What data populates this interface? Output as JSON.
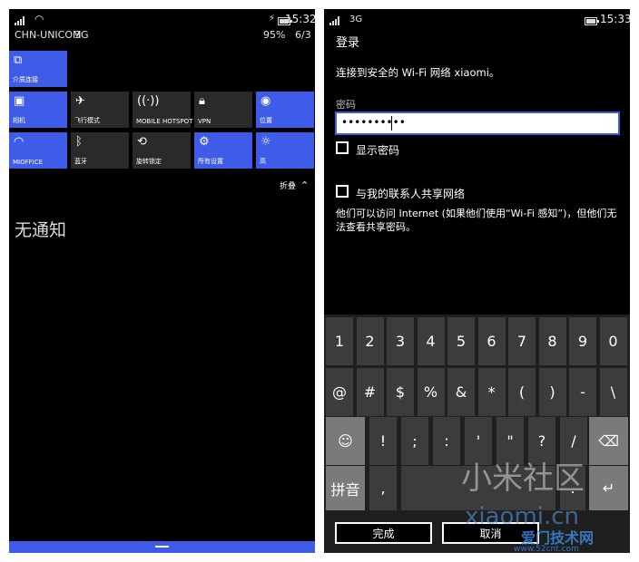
{
  "left_phone": {
    "carrier": "CHN-UNICOM",
    "network": "3G",
    "time": "15:32",
    "battery_percent": "95%",
    "date": "6/3",
    "battery_level": 0.95,
    "tiles_row1": [
      {
        "label": "介质连接",
        "icon": "connect-icon",
        "on": true
      }
    ],
    "tiles_row2": [
      {
        "label": "相机",
        "icon": "camera-icon",
        "on": true
      },
      {
        "label": "飞行模式",
        "icon": "airplane-icon",
        "on": false
      },
      {
        "label": "MOBILE HOTSPOT",
        "icon": "hotspot-icon",
        "on": false
      },
      {
        "label": "VPN",
        "icon": "lock-icon",
        "on": false
      },
      {
        "label": "位置",
        "icon": "location-icon",
        "on": true
      }
    ],
    "tiles_row3": [
      {
        "label": "MIOFFICE",
        "icon": "wifi-icon",
        "on": true
      },
      {
        "label": "蓝牙",
        "icon": "bluetooth-icon",
        "on": false
      },
      {
        "label": "旋转锁定",
        "icon": "rotation-lock-icon",
        "on": false
      },
      {
        "label": "所有设置",
        "icon": "gear-icon",
        "on": true
      },
      {
        "label": "高",
        "icon": "brightness-icon",
        "on": true
      }
    ],
    "collapse_label": "折叠",
    "no_notifications": "无通知",
    "accent": "#3f5ce8"
  },
  "right_phone": {
    "network": "3G",
    "time": "15:33",
    "battery_level": 0.95,
    "page_title": "登录",
    "connect_text": "连接到安全的 Wi-Fi 网络 xiaomi。",
    "password_label": "密码",
    "password_value": "••••••••••",
    "show_password_label": "显示密码",
    "share_label": "与我的联系人共享网络",
    "share_desc": "他们可以访问 Internet (如果他们使用“Wi-Fi 感知”)，但他们无法查看共享密码。",
    "keyboard": {
      "row1": [
        "1",
        "2",
        "3",
        "4",
        "5",
        "6",
        "7",
        "8",
        "9",
        "0"
      ],
      "row2": [
        "@",
        "#",
        "$",
        "%",
        "&",
        "*",
        "(",
        ")",
        "-",
        "\\"
      ],
      "row3": [
        ":-)",
        "!",
        ";",
        ":",
        "'",
        "\"",
        "?",
        "/",
        "⌫"
      ],
      "pinyin_label": "拼音",
      "comma": ",",
      "period": ".",
      "enter": "↵"
    },
    "done_button": "完成",
    "cancel_button": "取消"
  },
  "watermark": {
    "text1": "小米社区",
    "text2": "xiaomi.cn",
    "text3": "爱门技术网",
    "text4": "www.52cnt.com"
  }
}
